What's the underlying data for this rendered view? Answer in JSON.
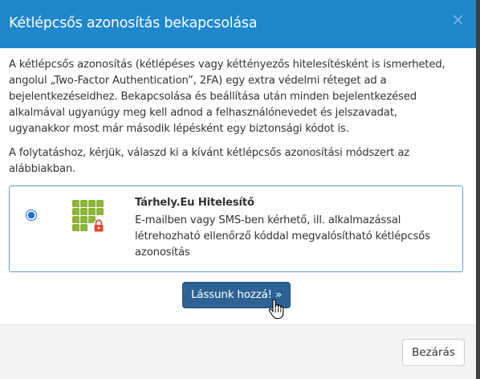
{
  "modal": {
    "title": "Kétlépcsős azonosítás bekapcsolása",
    "close_symbol": "×",
    "intro_paragraph": "A kétlépcsős azonosítás (kétlépéses vagy kéttényezős hitelesítésként is ismerheted, angolul „Two-Factor Authentication”, 2FA) egy extra védelmi réteget ad a bejelentkezéseidhez. Bekapcsolása és beállítása után minden bejelentkezésed alkalmával ugyanúgy meg kell adnod a felhasználónevedet és jelszavadat, ugyanakkor most már második lépésként egy biztonsági kódot is.",
    "instruction_paragraph": "A folytatáshoz, kérjük, válaszd ki a kívánt kétlépcsős azonosítási módszert az alábbiakban.",
    "methods": [
      {
        "name": "Tárhely.Eu Hitelesítő",
        "description": "E-mailben vagy SMS-ben kérhető, ill. alkalmazással létrehozható ellenőrző kóddal megvalósítható kétlépcsős azonosítás",
        "selected": true,
        "icon": "green-grid-lock-icon"
      }
    ],
    "continue_button_label": "Lássunk hozzá! »",
    "footer_close_label": "Bezárás"
  },
  "colors": {
    "header_bg": "#1f87cc",
    "primary_button": "#2e6294",
    "method_border": "#5f9ccf",
    "icon_green": "#8bb639",
    "lock_red": "#e24836"
  }
}
